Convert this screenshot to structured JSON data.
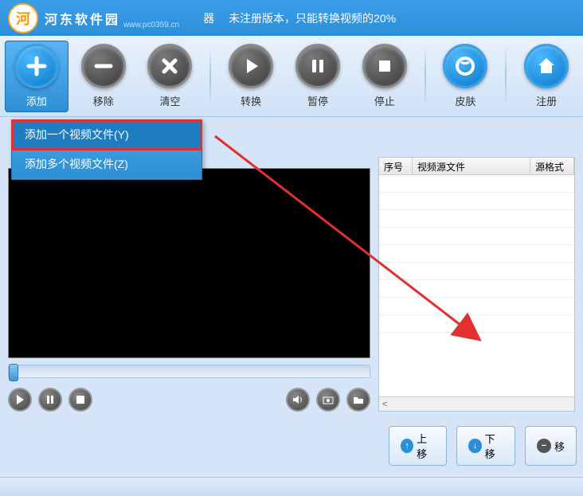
{
  "titlebar": {
    "brand": "河东软件园",
    "url": "www.pc0359.cn",
    "suffix": "器",
    "notice": "未注册版本，只能转换视频的20%"
  },
  "toolbar": {
    "add": "添加",
    "remove": "移除",
    "clear": "清空",
    "convert": "转换",
    "pause": "暂停",
    "stop": "停止",
    "skin": "皮肤",
    "register": "注册"
  },
  "dropdown": {
    "item1": "添加一个视频文件(Y)",
    "item2": "添加多个视频文件(Z)"
  },
  "table": {
    "col1": "序号",
    "col2": "视频源文件",
    "col3": "源格式"
  },
  "actions": {
    "up": "上移",
    "down": "下移",
    "del": "移"
  },
  "scroll_hint": "<"
}
